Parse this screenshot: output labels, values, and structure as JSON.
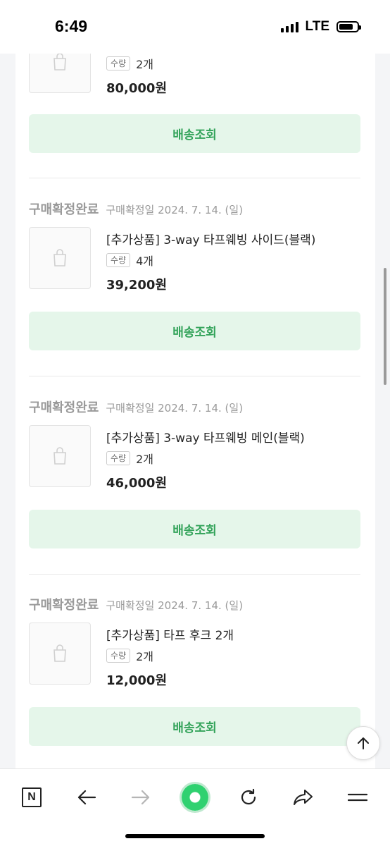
{
  "status_bar": {
    "time": "6:49",
    "network": "LTE"
  },
  "partial_order": {
    "qty_label": "수량",
    "qty_value": "2개",
    "price": "80,000원",
    "ship_button": "배송조회"
  },
  "orders": [
    {
      "status": "구매확정완료",
      "confirm_date": "구매확정일 2024. 7. 14. (일)",
      "product_name": "[추가상품] 3-way 타프웨빙 사이드(블랙)",
      "qty_label": "수량",
      "qty_value": "4개",
      "price": "39,200원",
      "ship_button": "배송조회"
    },
    {
      "status": "구매확정완료",
      "confirm_date": "구매확정일 2024. 7. 14. (일)",
      "product_name": "[추가상품] 3-way 타프웨빙 메인(블랙)",
      "qty_label": "수량",
      "qty_value": "2개",
      "price": "46,000원",
      "ship_button": "배송조회"
    },
    {
      "status": "구매확정완료",
      "confirm_date": "구매확정일 2024. 7. 14. (일)",
      "product_name": "[추가상품] 타프 후크 2개",
      "qty_label": "수량",
      "qty_value": "2개",
      "price": "12,000원",
      "ship_button": "배송조회"
    }
  ],
  "bottom_nav": {
    "logo_letter": "N",
    "icons": [
      "n-logo-icon",
      "back-arrow-icon",
      "forward-arrow-icon",
      "green-orb-icon",
      "refresh-icon",
      "share-icon",
      "menu-icon"
    ]
  },
  "colors": {
    "accent_green": "#33a35a",
    "button_bg": "#e5f6ea",
    "muted_text": "#9a9a9a"
  }
}
